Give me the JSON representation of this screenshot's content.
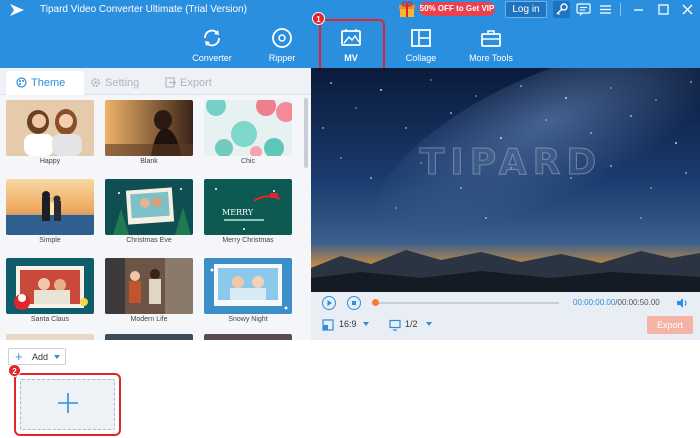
{
  "window": {
    "title": "Tipard Video Converter Ultimate (Trial Version)",
    "promo_label": "50% OFF to Get VIP",
    "login_label": "Log in"
  },
  "nav": {
    "items": [
      {
        "label": "Converter",
        "icon": "converter-icon"
      },
      {
        "label": "Ripper",
        "icon": "ripper-icon"
      },
      {
        "label": "MV",
        "icon": "mv-icon",
        "active": true
      },
      {
        "label": "Collage",
        "icon": "collage-icon"
      },
      {
        "label": "More Tools",
        "icon": "toolbox-icon"
      }
    ]
  },
  "annotations": {
    "step1": "1",
    "step2": "2"
  },
  "left_panel": {
    "tabs": [
      {
        "label": "Theme",
        "active": true
      },
      {
        "label": "Setting",
        "active": false
      },
      {
        "label": "Export",
        "active": false
      }
    ],
    "themes": [
      "Happy",
      "Blank",
      "Chic",
      "Simple",
      "Christmas Eve",
      "Merry Christmas",
      "Santa Claus",
      "Modern Life",
      "Snowy Night"
    ],
    "merry_text": "MERRY"
  },
  "preview": {
    "watermark": "TIPARD",
    "time_current": "00:00:00.00",
    "time_total": "/00:00:50.00",
    "progress": 0,
    "aspect_ratio": "16:9",
    "split": "1/2",
    "export_label": "Export"
  },
  "bottom": {
    "add_label": "Add"
  },
  "colors": {
    "brand": "#2b8fe0",
    "highlight": "#e3242b",
    "accent": "#ff7a29"
  }
}
